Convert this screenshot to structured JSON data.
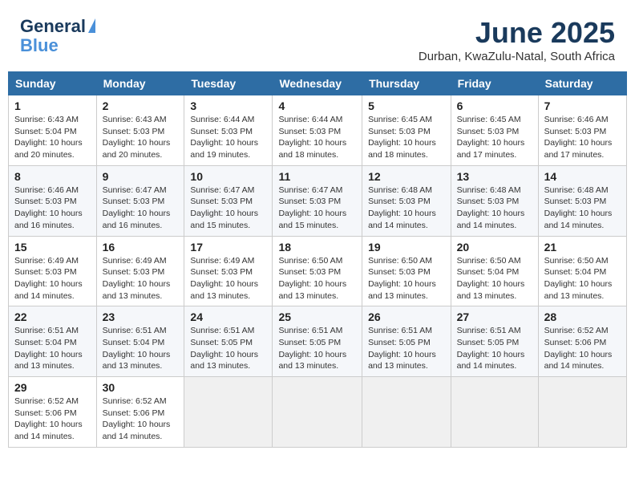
{
  "header": {
    "logo_line1": "General",
    "logo_line2": "Blue",
    "title": "June 2025",
    "subtitle": "Durban, KwaZulu-Natal, South Africa"
  },
  "calendar": {
    "days_of_week": [
      "Sunday",
      "Monday",
      "Tuesday",
      "Wednesday",
      "Thursday",
      "Friday",
      "Saturday"
    ],
    "weeks": [
      [
        {
          "day": "1",
          "info": "Sunrise: 6:43 AM\nSunset: 5:04 PM\nDaylight: 10 hours\nand 20 minutes."
        },
        {
          "day": "2",
          "info": "Sunrise: 6:43 AM\nSunset: 5:03 PM\nDaylight: 10 hours\nand 20 minutes."
        },
        {
          "day": "3",
          "info": "Sunrise: 6:44 AM\nSunset: 5:03 PM\nDaylight: 10 hours\nand 19 minutes."
        },
        {
          "day": "4",
          "info": "Sunrise: 6:44 AM\nSunset: 5:03 PM\nDaylight: 10 hours\nand 18 minutes."
        },
        {
          "day": "5",
          "info": "Sunrise: 6:45 AM\nSunset: 5:03 PM\nDaylight: 10 hours\nand 18 minutes."
        },
        {
          "day": "6",
          "info": "Sunrise: 6:45 AM\nSunset: 5:03 PM\nDaylight: 10 hours\nand 17 minutes."
        },
        {
          "day": "7",
          "info": "Sunrise: 6:46 AM\nSunset: 5:03 PM\nDaylight: 10 hours\nand 17 minutes."
        }
      ],
      [
        {
          "day": "8",
          "info": "Sunrise: 6:46 AM\nSunset: 5:03 PM\nDaylight: 10 hours\nand 16 minutes."
        },
        {
          "day": "9",
          "info": "Sunrise: 6:47 AM\nSunset: 5:03 PM\nDaylight: 10 hours\nand 16 minutes."
        },
        {
          "day": "10",
          "info": "Sunrise: 6:47 AM\nSunset: 5:03 PM\nDaylight: 10 hours\nand 15 minutes."
        },
        {
          "day": "11",
          "info": "Sunrise: 6:47 AM\nSunset: 5:03 PM\nDaylight: 10 hours\nand 15 minutes."
        },
        {
          "day": "12",
          "info": "Sunrise: 6:48 AM\nSunset: 5:03 PM\nDaylight: 10 hours\nand 14 minutes."
        },
        {
          "day": "13",
          "info": "Sunrise: 6:48 AM\nSunset: 5:03 PM\nDaylight: 10 hours\nand 14 minutes."
        },
        {
          "day": "14",
          "info": "Sunrise: 6:48 AM\nSunset: 5:03 PM\nDaylight: 10 hours\nand 14 minutes."
        }
      ],
      [
        {
          "day": "15",
          "info": "Sunrise: 6:49 AM\nSunset: 5:03 PM\nDaylight: 10 hours\nand 14 minutes."
        },
        {
          "day": "16",
          "info": "Sunrise: 6:49 AM\nSunset: 5:03 PM\nDaylight: 10 hours\nand 13 minutes."
        },
        {
          "day": "17",
          "info": "Sunrise: 6:49 AM\nSunset: 5:03 PM\nDaylight: 10 hours\nand 13 minutes."
        },
        {
          "day": "18",
          "info": "Sunrise: 6:50 AM\nSunset: 5:03 PM\nDaylight: 10 hours\nand 13 minutes."
        },
        {
          "day": "19",
          "info": "Sunrise: 6:50 AM\nSunset: 5:03 PM\nDaylight: 10 hours\nand 13 minutes."
        },
        {
          "day": "20",
          "info": "Sunrise: 6:50 AM\nSunset: 5:04 PM\nDaylight: 10 hours\nand 13 minutes."
        },
        {
          "day": "21",
          "info": "Sunrise: 6:50 AM\nSunset: 5:04 PM\nDaylight: 10 hours\nand 13 minutes."
        }
      ],
      [
        {
          "day": "22",
          "info": "Sunrise: 6:51 AM\nSunset: 5:04 PM\nDaylight: 10 hours\nand 13 minutes."
        },
        {
          "day": "23",
          "info": "Sunrise: 6:51 AM\nSunset: 5:04 PM\nDaylight: 10 hours\nand 13 minutes."
        },
        {
          "day": "24",
          "info": "Sunrise: 6:51 AM\nSunset: 5:05 PM\nDaylight: 10 hours\nand 13 minutes."
        },
        {
          "day": "25",
          "info": "Sunrise: 6:51 AM\nSunset: 5:05 PM\nDaylight: 10 hours\nand 13 minutes."
        },
        {
          "day": "26",
          "info": "Sunrise: 6:51 AM\nSunset: 5:05 PM\nDaylight: 10 hours\nand 13 minutes."
        },
        {
          "day": "27",
          "info": "Sunrise: 6:51 AM\nSunset: 5:05 PM\nDaylight: 10 hours\nand 14 minutes."
        },
        {
          "day": "28",
          "info": "Sunrise: 6:52 AM\nSunset: 5:06 PM\nDaylight: 10 hours\nand 14 minutes."
        }
      ],
      [
        {
          "day": "29",
          "info": "Sunrise: 6:52 AM\nSunset: 5:06 PM\nDaylight: 10 hours\nand 14 minutes."
        },
        {
          "day": "30",
          "info": "Sunrise: 6:52 AM\nSunset: 5:06 PM\nDaylight: 10 hours\nand 14 minutes."
        },
        {
          "day": "",
          "info": ""
        },
        {
          "day": "",
          "info": ""
        },
        {
          "day": "",
          "info": ""
        },
        {
          "day": "",
          "info": ""
        },
        {
          "day": "",
          "info": ""
        }
      ]
    ]
  }
}
